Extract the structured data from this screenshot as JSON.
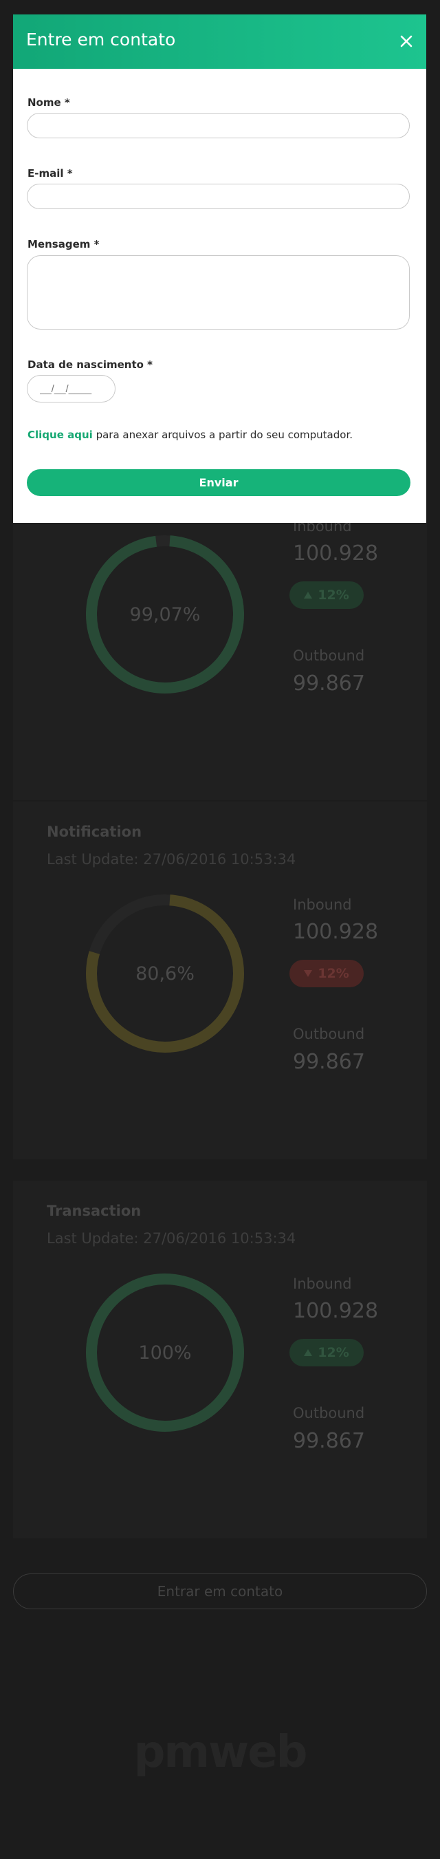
{
  "modal": {
    "title": "Entre em contato",
    "fields": {
      "name_label": "Nome *",
      "name_value": "",
      "email_label": "E-mail *",
      "email_value": "",
      "message_label": "Mensagem *",
      "message_value": "",
      "birthdate_label": "Data de nascimento *",
      "birthdate_placeholder": "__/__/____"
    },
    "attach_link": "Clique aqui",
    "attach_text": " para anexar arquivos a partir do seu computador.",
    "submit_label": "Enviar"
  },
  "cards": [
    {
      "title": "",
      "last_update": "",
      "donut_label": "99,07%",
      "donut_fraction": 0.9907,
      "donut_color": "#284a36",
      "inbound_label": "Inbound",
      "inbound_value": "100.928",
      "badge_direction": "up",
      "badge_value": "12%",
      "outbound_label": "Outbound",
      "outbound_value": "99.867"
    },
    {
      "title": "Notification",
      "last_update": "Last Update:  27/06/2016  10:53:34",
      "donut_label": "80,6%",
      "donut_fraction": 0.806,
      "donut_color": "#4a4423",
      "inbound_label": "Inbound",
      "inbound_value": "100.928",
      "badge_direction": "down",
      "badge_value": "12%",
      "outbound_label": "Outbound",
      "outbound_value": "99.867"
    },
    {
      "title": "Transaction",
      "last_update": "Last Update:  27/06/2016  10:53:34",
      "donut_label": "100%",
      "donut_fraction": 1.0,
      "donut_color": "#284a36",
      "inbound_label": "Inbound",
      "inbound_value": "100.928",
      "badge_direction": "up",
      "badge_value": "12%",
      "outbound_label": "Outbound",
      "outbound_value": "99.867"
    }
  ],
  "contact_button": "Entrar em contato",
  "footer_logo": "pmweb",
  "icons": {
    "close": "close-icon",
    "badge_up": "triangle-up-icon",
    "badge_down": "triangle-down-icon"
  },
  "colors": {
    "accent": "#16b379",
    "header_start": "#12a777",
    "header_end": "#1dc48f",
    "link": "#17a873"
  }
}
